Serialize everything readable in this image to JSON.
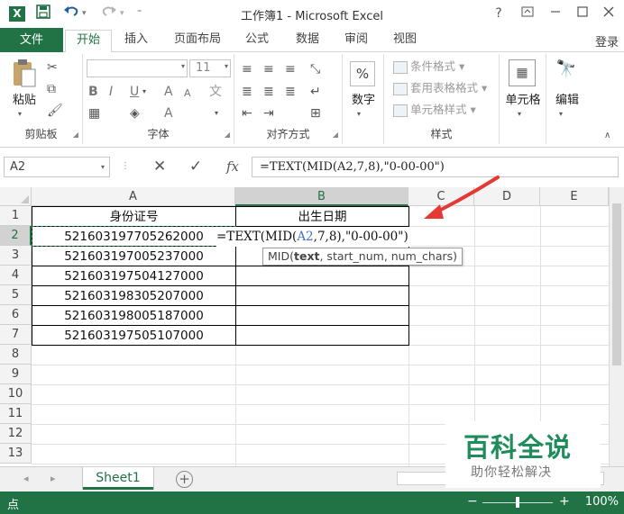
{
  "window": {
    "title": "工作簿1 - Microsoft Excel",
    "help": "?",
    "app_icon": "excel-icon"
  },
  "quick_access": {
    "save_icon": "save-icon",
    "undo_icon": "undo-icon",
    "redo_icon": "redo-icon",
    "customize_icon": "customize-qat-icon"
  },
  "tabs": [
    {
      "label": "文件"
    },
    {
      "label": "开始"
    },
    {
      "label": "插入"
    },
    {
      "label": "页面布局"
    },
    {
      "label": "公式"
    },
    {
      "label": "数据"
    },
    {
      "label": "审阅"
    },
    {
      "label": "视图"
    }
  ],
  "account": {
    "login": "登录"
  },
  "ribbon": {
    "clipboard": {
      "label": "剪贴板",
      "paste": "粘贴"
    },
    "font": {
      "label": "字体",
      "size": "11",
      "bold": "B",
      "italic": "I",
      "underline": "U",
      "grow": "A",
      "shrink": "A",
      "color": "A",
      "phonetic": "文"
    },
    "alignment": {
      "label": "对齐方式"
    },
    "number": {
      "label": "数字",
      "percent": "%"
    },
    "styles": {
      "label": "样式",
      "conditional": "条件格式",
      "table": "套用表格格式",
      "cell": "单元格样式"
    },
    "cells": {
      "label": "单元格"
    },
    "editing": {
      "label": "编辑"
    }
  },
  "formula_bar": {
    "name_box": "A2",
    "cancel": "✕",
    "enter": "✓",
    "fx": "fx",
    "formula": "=TEXT(MID(A2,7,8),\"0-00-00\")"
  },
  "grid": {
    "columns": [
      "A",
      "B",
      "C",
      "D",
      "E"
    ],
    "rows": [
      "1",
      "2",
      "3",
      "4",
      "5",
      "6",
      "7",
      "8",
      "9",
      "10",
      "11",
      "12",
      "13"
    ],
    "header_a": "身份证号",
    "header_b": "出生日期",
    "ids": [
      "521603197705262000",
      "521603197005237000",
      "521603197504127000",
      "521603198305207000",
      "521603198005187000",
      "521603197505107000"
    ],
    "editing_prefix": "=TEXT(MID(",
    "editing_ref": "A2",
    "editing_suffix": ",7,8),\"0-00-00\")",
    "tooltip_fn": "MID(",
    "tooltip_arg1": "text",
    "tooltip_rest": ", start_num, num_chars)"
  },
  "sheets": {
    "tab": "Sheet1",
    "add": "+"
  },
  "status": {
    "mode": "点",
    "zoom": "100%",
    "zoom_fraction": 0.5
  },
  "watermark": {
    "main": "百科全说",
    "sub": "助你轻松解决"
  },
  "colors": {
    "accent": "#217346",
    "arrow": "#e53935",
    "ref_blue": "#4472c4"
  }
}
